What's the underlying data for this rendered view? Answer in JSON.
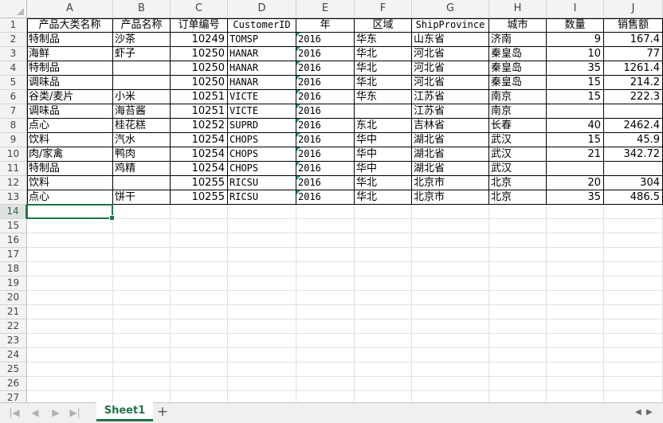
{
  "columns": [
    "A",
    "B",
    "C",
    "D",
    "E",
    "F",
    "G",
    "H",
    "I",
    "J"
  ],
  "selected_row": 14,
  "rows": [
    [
      "产品大类名称",
      "产品名称",
      "订单编号",
      "CustomerID",
      "年",
      "区域",
      "ShipProvince",
      "城市",
      "数量",
      "销售额"
    ],
    [
      "特制品",
      "沙茶",
      "10249",
      "TOMSP",
      "2016",
      "华东",
      "山东省",
      "济南",
      "9",
      "167.4"
    ],
    [
      "海鲜",
      "虾子",
      "10250",
      "HANAR",
      "2016",
      "华北",
      "河北省",
      "秦皇岛",
      "10",
      "77"
    ],
    [
      "特制品",
      "",
      "10250",
      "HANAR",
      "2016",
      "华北",
      "河北省",
      "秦皇岛",
      "35",
      "1261.4"
    ],
    [
      "调味品",
      "",
      "10250",
      "HANAR",
      "2016",
      "华北",
      "河北省",
      "秦皇岛",
      "15",
      "214.2"
    ],
    [
      "谷类/麦片",
      "小米",
      "10251",
      "VICTE",
      "2016",
      "华东",
      "江苏省",
      "南京",
      "15",
      "222.3"
    ],
    [
      "调味品",
      "海苔酱",
      "10251",
      "VICTE",
      "2016",
      "",
      "江苏省",
      "南京",
      "",
      ""
    ],
    [
      "点心",
      "桂花糕",
      "10252",
      "SUPRD",
      "2016",
      "东北",
      "吉林省",
      "长春",
      "40",
      "2462.4"
    ],
    [
      "饮料",
      "汽水",
      "10254",
      "CHOPS",
      "2016",
      "华中",
      "湖北省",
      "武汉",
      "15",
      "45.9"
    ],
    [
      "肉/家禽",
      "鸭肉",
      "10254",
      "CHOPS",
      "2016",
      "华中",
      "湖北省",
      "武汉",
      "21",
      "342.72"
    ],
    [
      "特制品",
      "鸡精",
      "10254",
      "CHOPS",
      "2016",
      "华中",
      "湖北省",
      "武汉",
      "",
      ""
    ],
    [
      "饮料",
      "",
      "10255",
      "RICSU",
      "2016",
      "华北",
      "北京市",
      "北京",
      "20",
      "304"
    ],
    [
      "点心",
      "饼干",
      "10255",
      "RICSU",
      "2016",
      "华北",
      "北京市",
      "北京",
      "35",
      "486.5"
    ]
  ],
  "sheet_tab": "Sheet1",
  "add_sheet_icon": "plus-icon",
  "nav_icons": [
    "first-sheet-icon",
    "prev-sheet-icon",
    "next-sheet-icon",
    "last-sheet-icon"
  ],
  "colors": {
    "accent": "#217346",
    "grid": "#e1e1e1",
    "header_bg": "#f3f3f3",
    "text_marker": "#21a366"
  }
}
